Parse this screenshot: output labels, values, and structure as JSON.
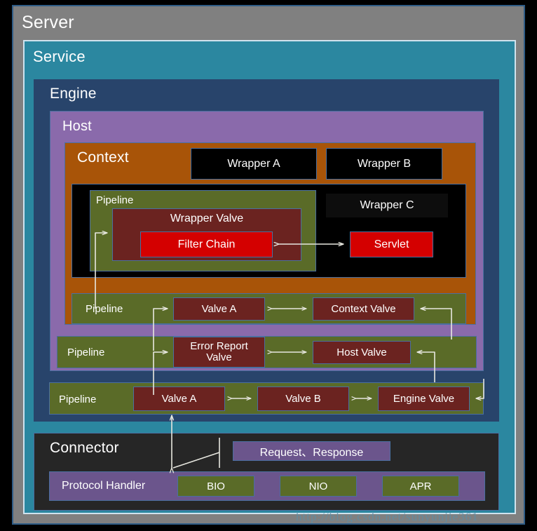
{
  "containers": {
    "server": "Server",
    "service": "Service",
    "engine": "Engine",
    "host": "Host",
    "context": "Context",
    "connector": "Connector"
  },
  "wrappers": {
    "a": "Wrapper A",
    "b": "Wrapper B",
    "c": "Wrapper C"
  },
  "wrapper_pipeline": {
    "label": "Pipeline",
    "valve": "Wrapper Valve",
    "filter_chain": "Filter Chain"
  },
  "servlet": "Servlet",
  "context_pipeline": {
    "label": "Pipeline",
    "valve_a": "Valve A",
    "context_valve": "Context Valve"
  },
  "host_pipeline": {
    "label": "Pipeline",
    "error_report_valve": "Error Report Valve",
    "host_valve": "Host Valve"
  },
  "engine_pipeline": {
    "label": "Pipeline",
    "valve_a": "Valve A",
    "valve_b": "Valve B",
    "engine_valve": "Engine Valve"
  },
  "connector_section": {
    "request_response": "Request、Response",
    "protocol_handler": "Protocol Handler",
    "protocols": [
      "BIO",
      "NIO",
      "APR"
    ]
  },
  "watermark": "http://blog.csdn.net/sunyunjie361",
  "colors": {
    "server_bg": "#808080",
    "service_bg": "#2b87a0",
    "engine_bg": "#28446b",
    "host_bg": "#8a6aab",
    "context_bg": "#a85408",
    "pipeline_bg": "#5a6b28",
    "valve_bg": "#6b2320",
    "red_bg": "#d40000",
    "connector_bg": "#262626",
    "protocol_bg": "#6b558c",
    "border": "#4a6fa0",
    "arrow": "#e8e8e0"
  }
}
